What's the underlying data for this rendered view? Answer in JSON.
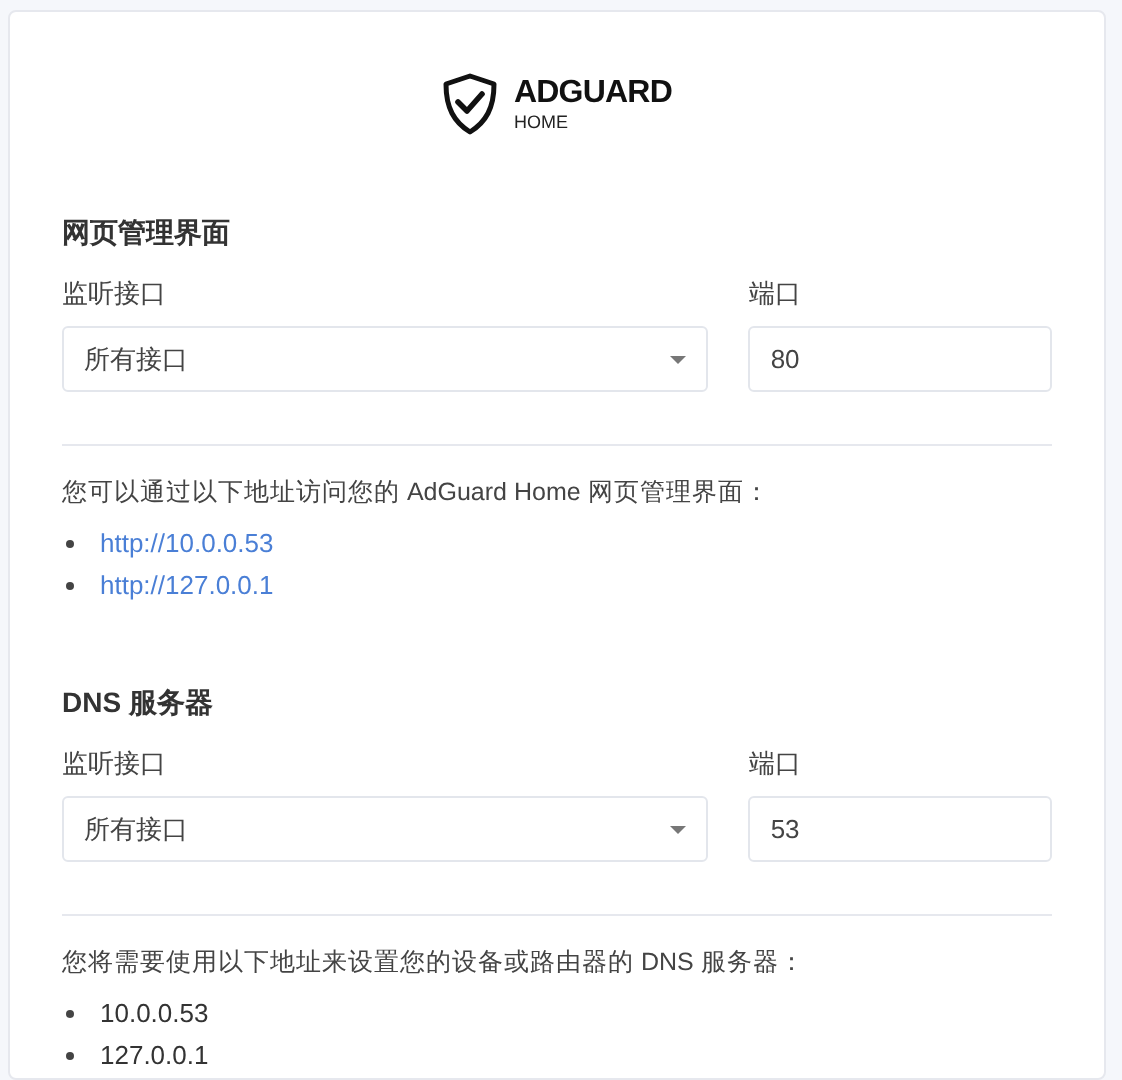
{
  "logo": {
    "title": "ADGUARD",
    "subtitle": "HOME"
  },
  "sections": [
    {
      "title": "网页管理界面",
      "interface_label": "监听接口",
      "interface_value": "所有接口",
      "port_label": "端口",
      "port_value": "80",
      "note": "您可以通过以下地址访问您的 AdGuard Home 网页管理界面：",
      "addresses": [
        {
          "text": "http://10.0.0.53",
          "kind": "link"
        },
        {
          "text": "http://127.0.0.1",
          "kind": "link"
        }
      ]
    },
    {
      "title": "DNS 服务器",
      "interface_label": "监听接口",
      "interface_value": "所有接口",
      "port_label": "端口",
      "port_value": "53",
      "note": "您将需要使用以下地址来设置您的设备或路由器的 DNS 服务器：",
      "addresses": [
        {
          "text": "10.0.0.53",
          "kind": "plain"
        },
        {
          "text": "127.0.0.1",
          "kind": "plain"
        }
      ]
    }
  ]
}
